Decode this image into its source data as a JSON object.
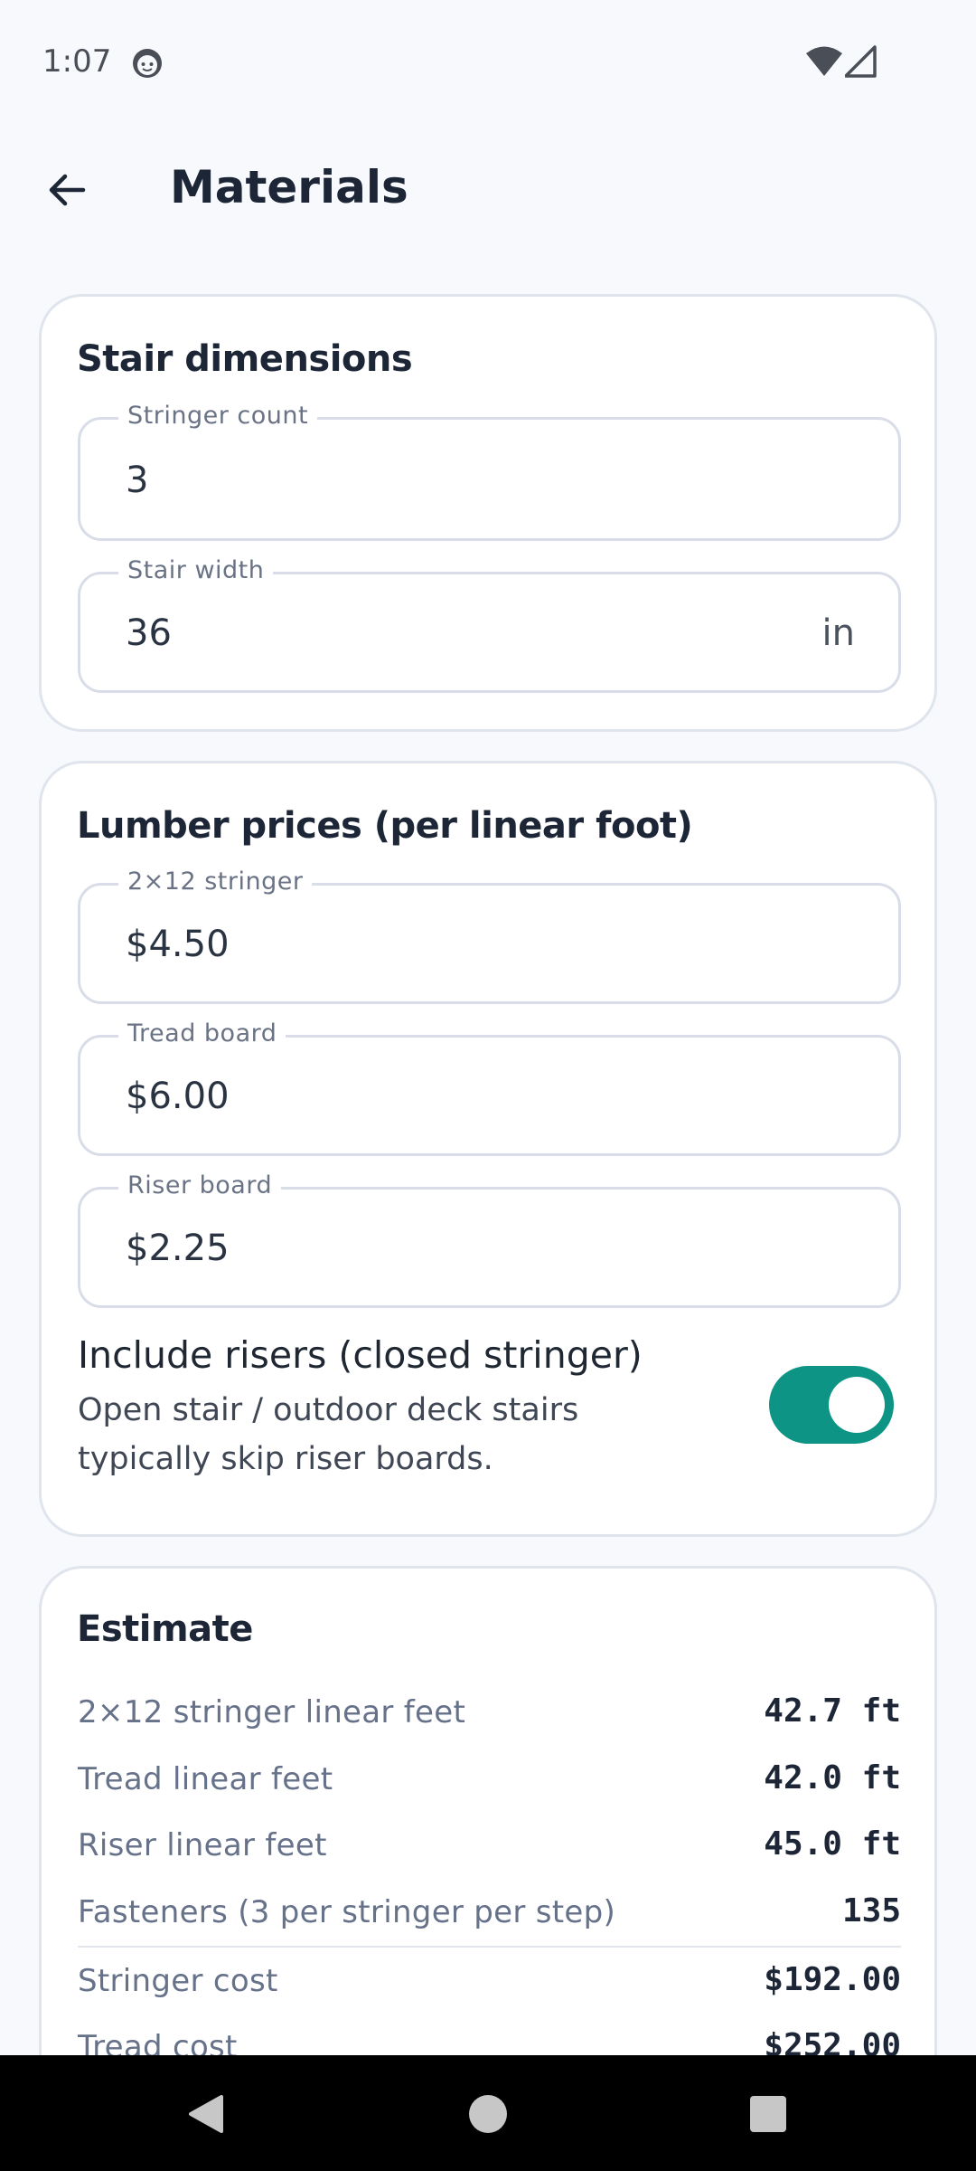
{
  "status_bar": {
    "time": "1:07",
    "icons": [
      "face-icon",
      "wifi-icon",
      "signal-icon"
    ]
  },
  "app_bar": {
    "back_icon": "arrow-left-icon",
    "title": "Materials"
  },
  "stair_dimensions": {
    "title": "Stair dimensions",
    "stringer_count": {
      "label": "Stringer count",
      "value": "3"
    },
    "stair_width": {
      "label": "Stair width",
      "value": "36",
      "suffix": "in"
    }
  },
  "lumber_prices": {
    "title": "Lumber prices (per linear foot)",
    "stringer": {
      "label": "2×12 stringer",
      "value": "$4.50"
    },
    "tread": {
      "label": "Tread board",
      "value": "$6.00"
    },
    "riser": {
      "label": "Riser board",
      "value": "$2.25"
    },
    "include_risers": {
      "title": "Include risers (closed stringer)",
      "description": "Open stair / outdoor deck stairs typically skip riser boards.",
      "enabled": true
    }
  },
  "estimate": {
    "title": "Estimate",
    "rows": [
      {
        "label": "2×12 stringer linear feet",
        "value": "42.7 ft"
      },
      {
        "label": "Tread linear feet",
        "value": "42.0 ft"
      },
      {
        "label": "Riser linear feet",
        "value": "45.0 ft"
      },
      {
        "label": "Fasteners (3 per stringer per step)",
        "value": "135"
      },
      {
        "label": "Stringer cost",
        "value": "$192.00"
      },
      {
        "label": "Tread cost",
        "value": "$252.00"
      }
    ]
  },
  "colors": {
    "accent": "#0d9484",
    "background": "#f7f9fc",
    "card": "#ffffff"
  },
  "nav_bar": {
    "icons": [
      "back-triangle-icon",
      "home-circle-icon",
      "recents-square-icon"
    ]
  }
}
